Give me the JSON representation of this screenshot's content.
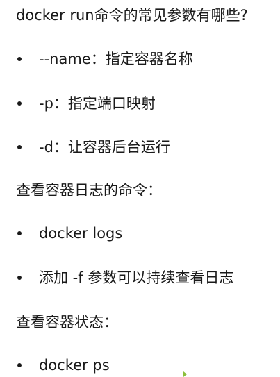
{
  "heading_run": "docker run命令的常见参数有哪些?",
  "run_params": [
    "--name：指定容器名称",
    "-p：指定端口映射",
    "-d：让容器后台运行"
  ],
  "heading_logs": "查看容器日志的命令：",
  "logs_items": [
    "docker logs",
    "添加 -f 参数可以持续查看日志"
  ],
  "heading_status": "查看容器状态：",
  "status_items": [
    "docker ps"
  ],
  "colors": {
    "text": "#1a1a1a",
    "background": "#ffffff",
    "cursor": "#8bbf3a"
  }
}
